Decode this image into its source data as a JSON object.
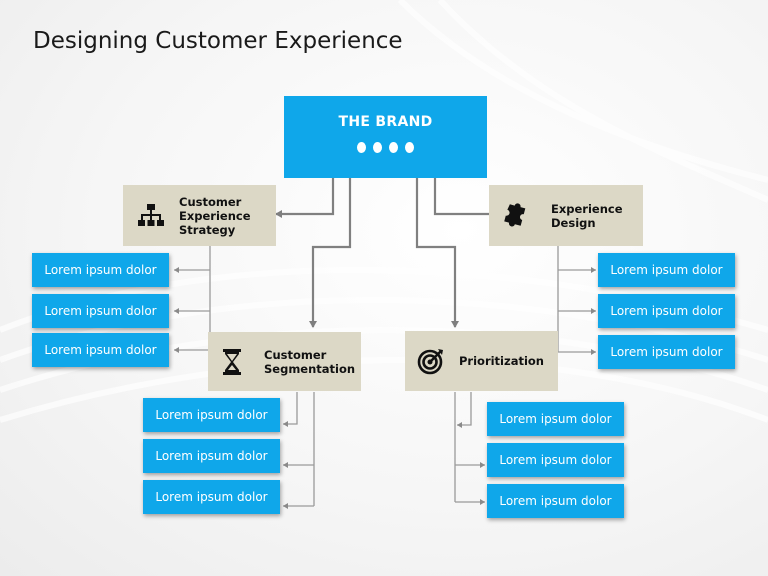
{
  "title": "Designing Customer Experience",
  "brand": {
    "label": "THE BRAND",
    "dots": 4
  },
  "colors": {
    "accent_blue": "#0fa7ea",
    "category_bg": "#dcd8c6",
    "connector": "#8a8a8a"
  },
  "categories": [
    {
      "id": "strategy",
      "label": "Customer\nExperience\nStrategy",
      "icon": "org-chart-icon",
      "items": [
        "Lorem ipsum dolor",
        "Lorem ipsum dolor",
        "Lorem ipsum dolor"
      ]
    },
    {
      "id": "design",
      "label": "Experience\nDesign",
      "icon": "puzzle-piece-icon",
      "items": [
        "Lorem ipsum dolor",
        "Lorem ipsum dolor",
        "Lorem ipsum dolor"
      ]
    },
    {
      "id": "segmentation",
      "label": "Customer\nSegmentation",
      "icon": "hourglass-icon",
      "items": [
        "Lorem ipsum dolor",
        "Lorem ipsum dolor",
        "Lorem ipsum dolor"
      ]
    },
    {
      "id": "prioritization",
      "label": "Prioritization",
      "icon": "target-icon",
      "items": [
        "Lorem ipsum dolor",
        "Lorem ipsum dolor",
        "Lorem ipsum dolor"
      ]
    }
  ]
}
